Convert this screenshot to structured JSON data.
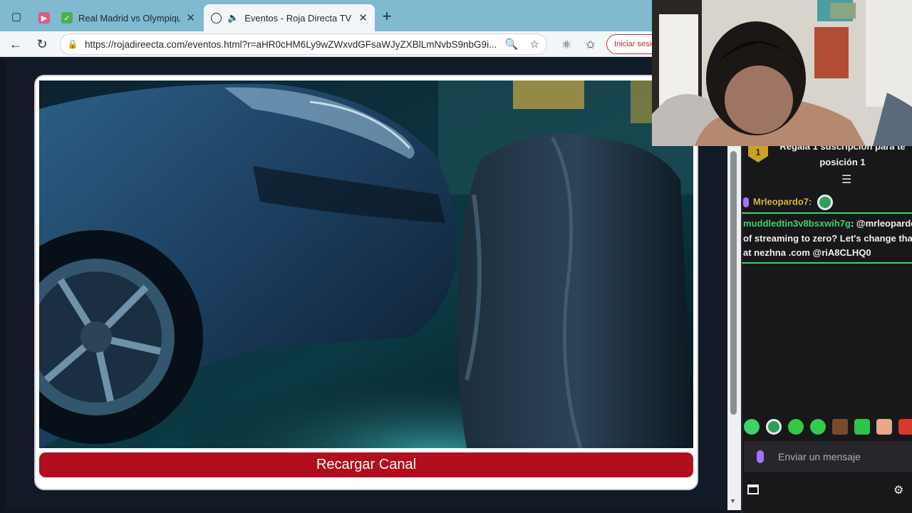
{
  "browser": {
    "tabs": [
      {
        "label": "",
        "favicon": "youtube-icon"
      },
      {
        "label": "Real Madrid vs Olympique de",
        "favicon": "check-icon"
      },
      {
        "label": "Eventos - Roja Directa TV",
        "favicon": "globe-icon",
        "active": true
      }
    ],
    "url": "https://rojadireecta.com/eventos.html?r=aHR0cHM6Ly9wZWxvdGFsaWJyZXBlLmNvbS9nbG9i...",
    "signin_label": "Iniciar sesión"
  },
  "page": {
    "reload_button": "Recargar Canal"
  },
  "chat": {
    "pinned_text_line1": "Regala 1 suscripción para te",
    "pinned_text_line2": "posición 1",
    "pinned_badge": "1",
    "messages": [
      {
        "user": "Mrleopardo7:",
        "text": "",
        "emote": true
      },
      {
        "user": "muddledtin3v8bsxwih7g",
        "text": ": @mrleopardo",
        "line2": "of streaming to zero? Let's change that",
        "line3": "at nezhna .com @riA8CLHQ0"
      }
    ],
    "input_placeholder": "Enviar un mensaje"
  },
  "colors": {
    "accent_red": "#b10f1e",
    "twitch_purple": "#a970ff",
    "highlight_green": "#3cd36b",
    "username_gold": "#d8b33a"
  }
}
